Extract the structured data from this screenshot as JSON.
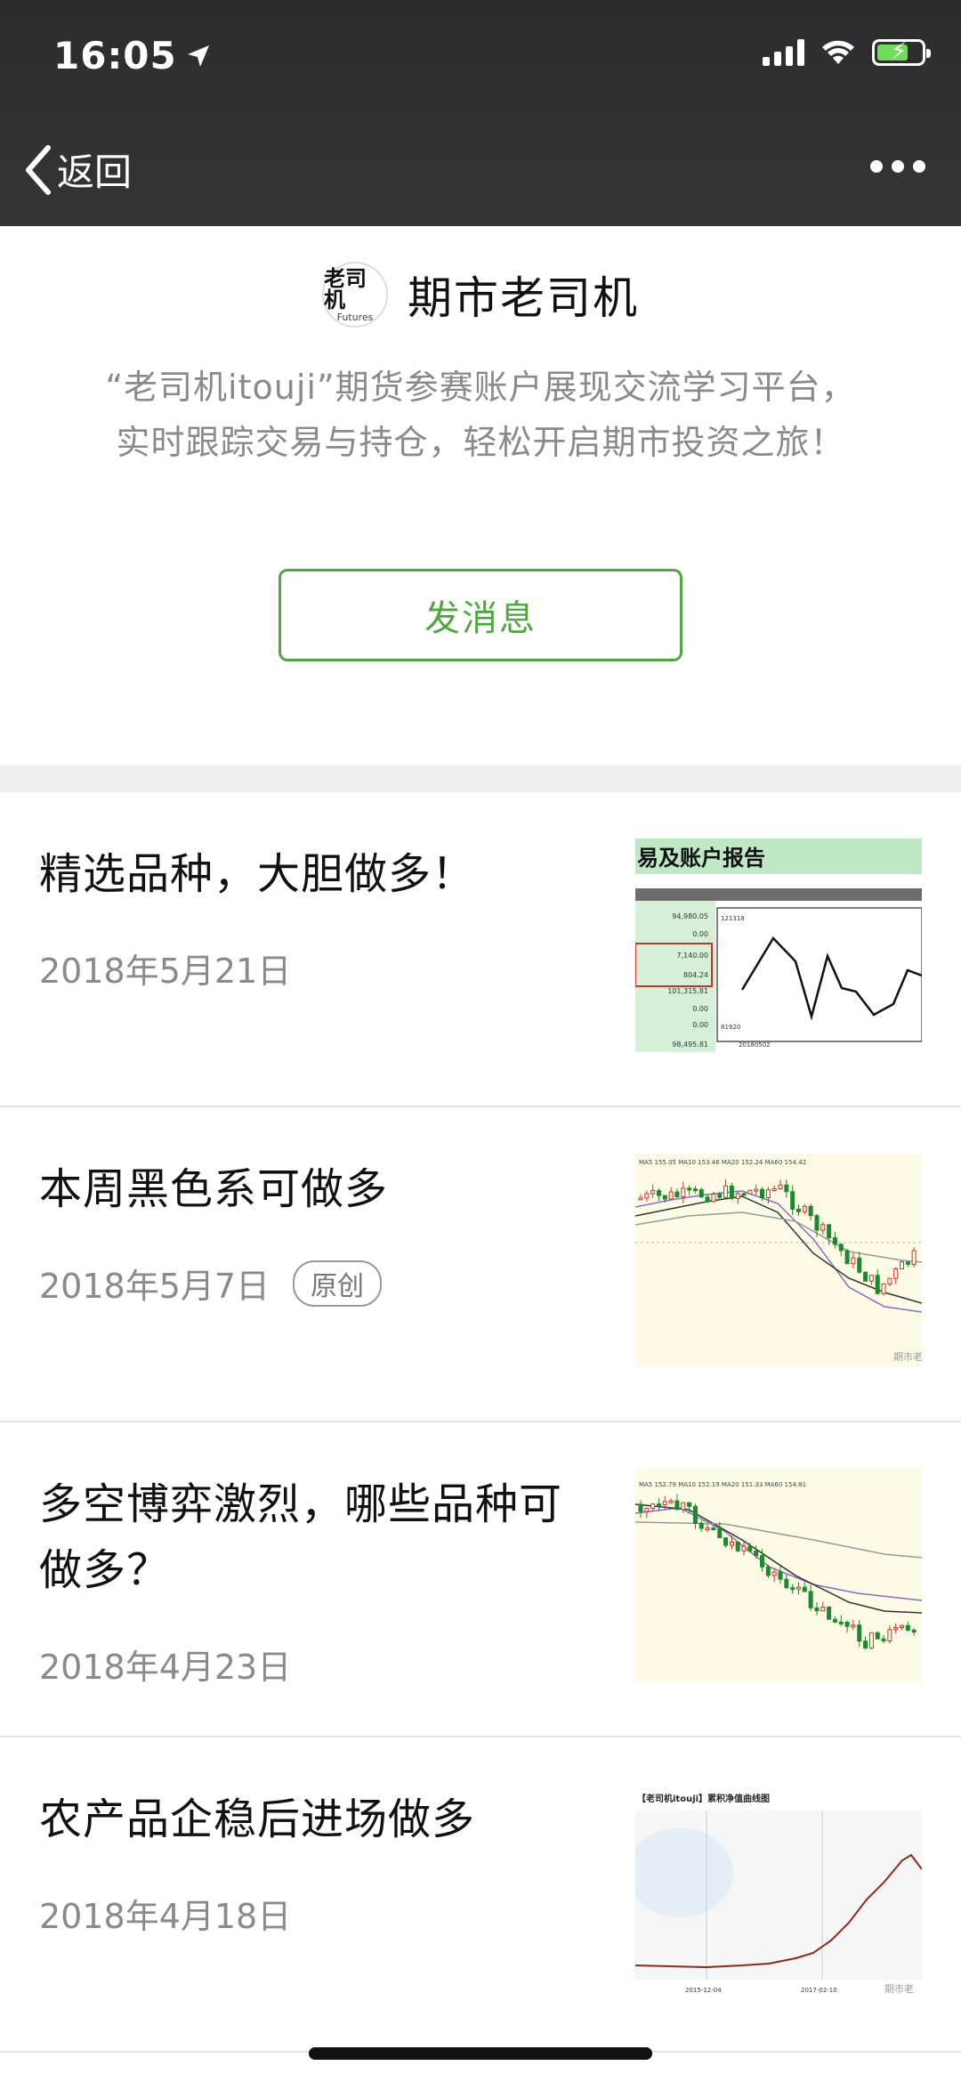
{
  "status": {
    "time": "16:05"
  },
  "nav": {
    "back_label": "返回"
  },
  "account": {
    "logo_text": "老司机",
    "logo_subtext": "Futures",
    "name": "期市老司机",
    "description_line1": "“老司机itouji”期货参赛账户展现交流学习平台，",
    "description_line2": "实时跟踪交易与持仓，轻松开启期市投资之旅！",
    "send_message_label": "发消息"
  },
  "articles": [
    {
      "title": "精选品种，大胆做多！",
      "date": "2018年5月21日",
      "badge": "",
      "thumb": "report-chart-thumbnail"
    },
    {
      "title": "本周黑色系可做多",
      "date": "2018年5月7日",
      "badge": "原创",
      "thumb": "candlestick-thumbnail"
    },
    {
      "title": "多空博弈激烈，哪些品种可做多？",
      "date": "2018年4月23日",
      "badge": "",
      "thumb": "candlestick-thumbnail"
    },
    {
      "title": "农产品企稳后进场做多",
      "date": "2018年4月18日",
      "badge": "",
      "thumb": "net-value-curve-thumbnail"
    }
  ],
  "thumb_text": {
    "report_title": "易及账户报告",
    "report_values": [
      "94,980.05",
      "0.00",
      "7,140.00",
      "804.24",
      "101,315.81",
      "0.00",
      "0.00",
      "98,495.81"
    ],
    "report_axis_top": "121318",
    "report_axis_bottom": "81920",
    "report_x_label": "20180502",
    "ma_line_2": "MA5 155.05  MA10 153.46  MA20 152.24  MA60 154.42",
    "ma_line_3": "MA5 152.79  MA10 152.19  MA20 151.33  MA60 154.81",
    "net_value_title": "【老司机itouji】累积净值曲线图",
    "net_value_x1": "2015-12-04",
    "net_value_x2": "2017-02-10",
    "watermark": "期市老"
  }
}
